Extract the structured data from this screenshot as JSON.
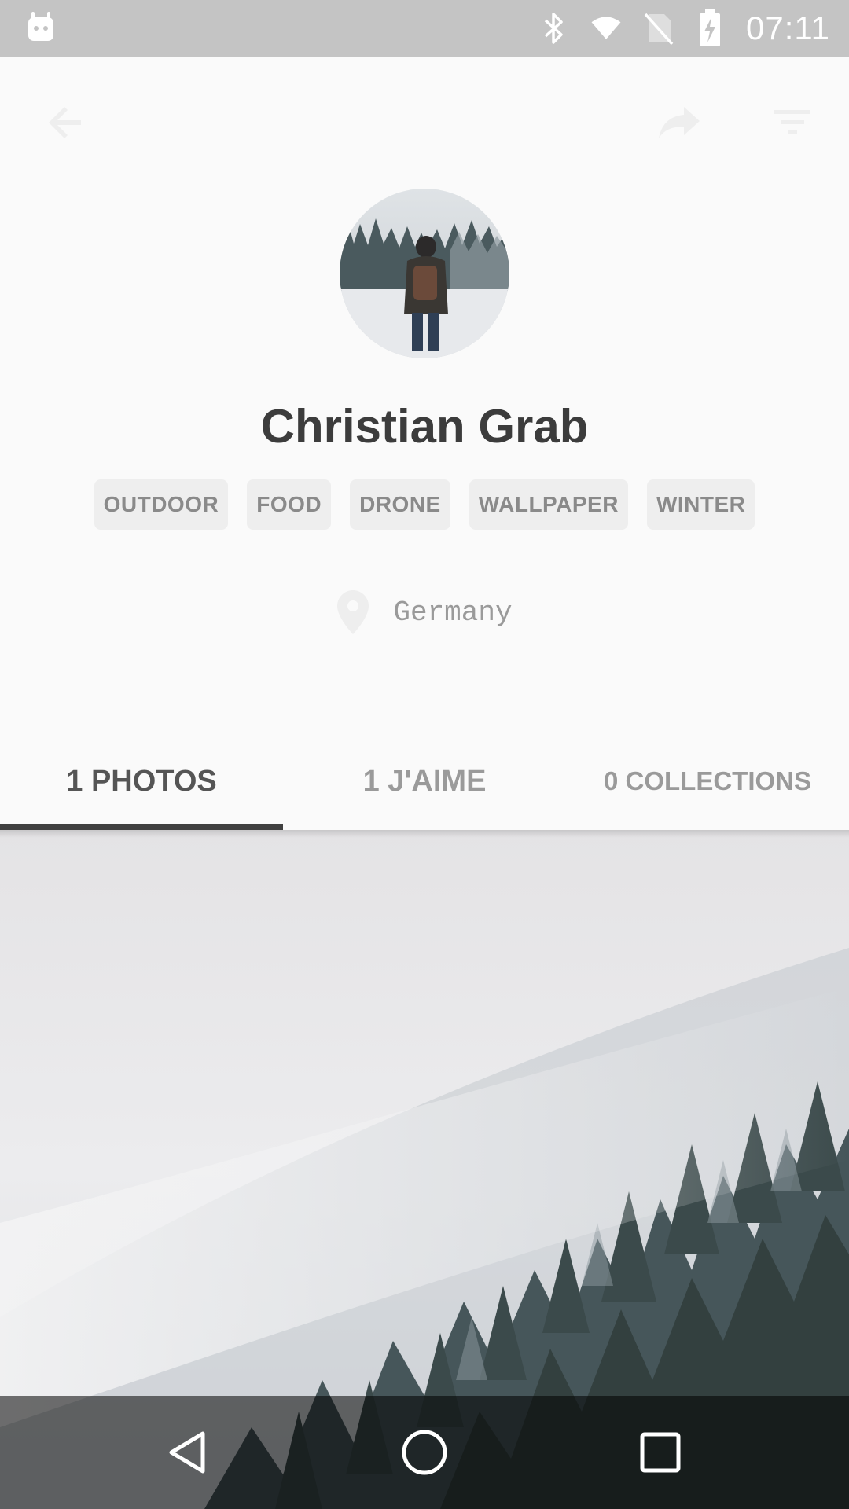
{
  "status_bar": {
    "time": "07:11"
  },
  "profile": {
    "name": "Christian Grab",
    "tags": [
      "OUTDOOR",
      "FOOD",
      "DRONE",
      "WALLPAPER",
      "WINTER"
    ],
    "location": "Germany"
  },
  "tabs": [
    {
      "label": "1 PHOTOS",
      "active": true
    },
    {
      "label": "1 J'AIME",
      "active": false
    },
    {
      "label": "0 COLLECTIONS",
      "active": false
    }
  ],
  "colors": {
    "status_bar": "#c4c4c4",
    "background": "#fafafa",
    "tab_indicator": "#404040",
    "tag_bg": "#eeeeee"
  },
  "icons": {
    "toolbar": [
      "arrow-back-icon",
      "share-icon",
      "filter-icon"
    ],
    "navigation": [
      "nav-back-icon",
      "nav-home-icon",
      "nav-recent-icon"
    ]
  }
}
